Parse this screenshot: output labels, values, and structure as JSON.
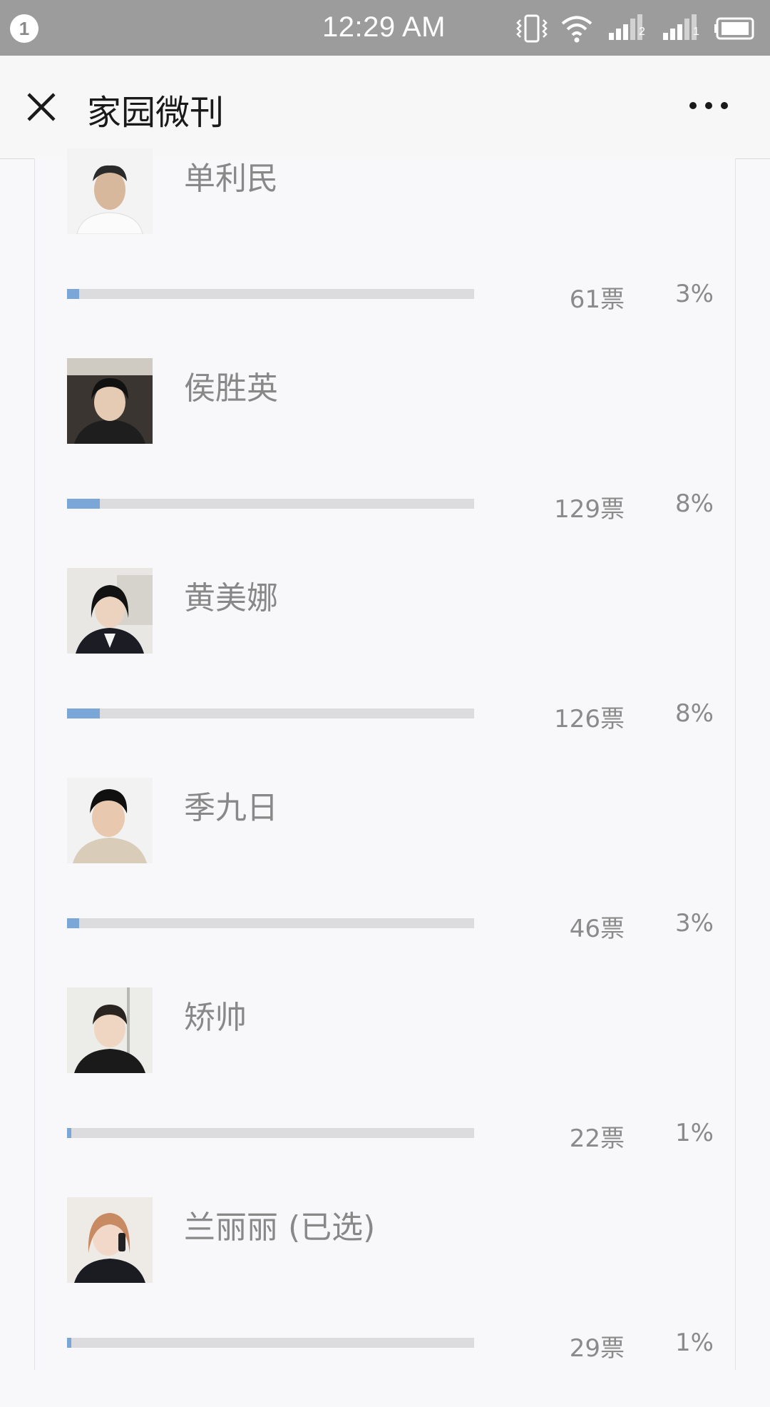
{
  "status_bar": {
    "notification_count": "1",
    "time": "12:29 AM",
    "sim1_label": "2",
    "sim2_label": "1"
  },
  "app_bar": {
    "title": "家园微刊"
  },
  "candidates": [
    {
      "name": "单利民",
      "votes": "61票",
      "percent": "3%",
      "share": 0.03
    },
    {
      "name": "侯胜英",
      "votes": "129票",
      "percent": "8%",
      "share": 0.08
    },
    {
      "name": "黄美娜",
      "votes": "126票",
      "percent": "8%",
      "share": 0.08
    },
    {
      "name": "季九日",
      "votes": "46票",
      "percent": "3%",
      "share": 0.03
    },
    {
      "name": "矫帅",
      "votes": "22票",
      "percent": "1%",
      "share": 0.01
    },
    {
      "name": "兰丽丽 (已选)",
      "votes": "29票",
      "percent": "1%",
      "share": 0.01
    }
  ],
  "colors": {
    "bar_fill": "#7aa7d8",
    "bar_track": "#dcdcde",
    "status_bar": "#9c9c9c"
  },
  "icons": [
    "close-icon",
    "more-icon",
    "vibrate-icon",
    "wifi-icon",
    "signal-icon",
    "battery-icon"
  ]
}
